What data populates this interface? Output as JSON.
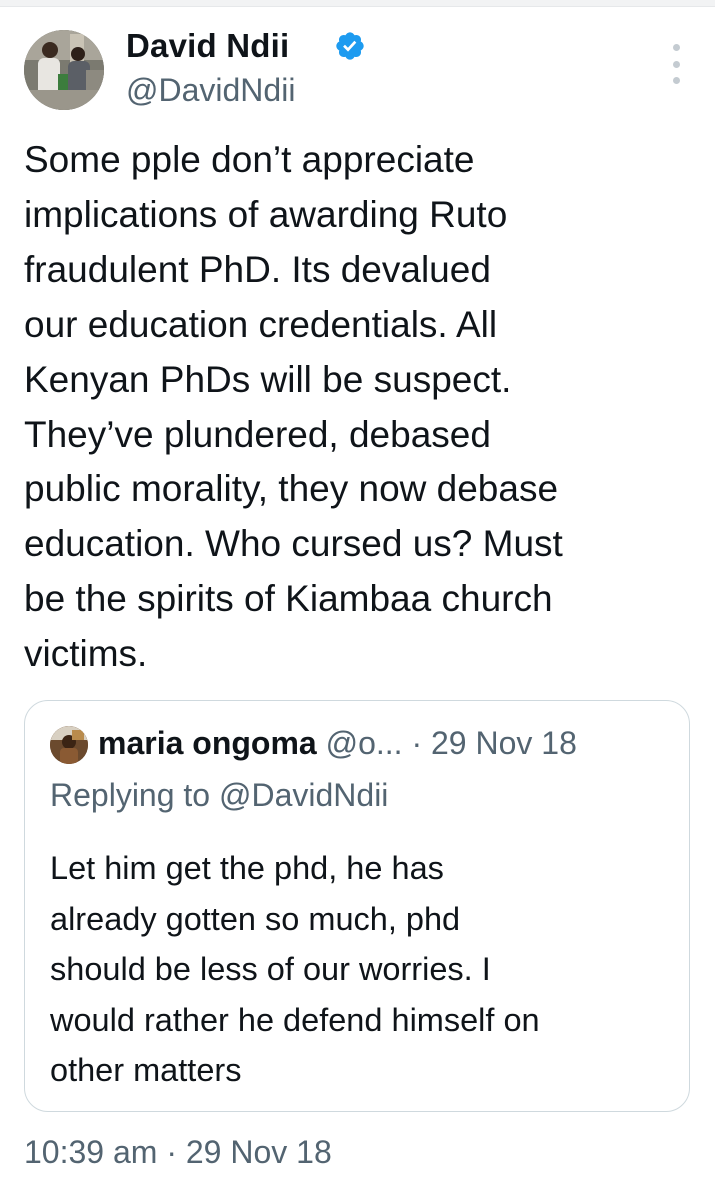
{
  "tweet": {
    "author": {
      "name": "David Ndii",
      "handle": "@DavidNdii",
      "verified": true
    },
    "text_lines": [
      "Some pple don’t appreciate",
      "implications of awarding Ruto",
      "fraudulent PhD. Its devalued",
      "our education credentials. All",
      "Kenyan PhDs will be suspect.",
      "They’ve plundered, debased",
      "public morality, they now debase",
      "education. Who cursed us? Must",
      "be the spirits of Kiambaa church",
      "victims."
    ],
    "time": "10:39 am",
    "separator": "·",
    "date": "29 Nov 18"
  },
  "quoted_tweet": {
    "author_name": "maria ongoma",
    "author_handle": "@o...",
    "separator": "·",
    "date": "29 Nov 18",
    "replying_to": "Replying to @DavidNdii",
    "text_lines": [
      "Let him get the phd, he has",
      "already gotten so much, phd",
      "should be less of our worries. I",
      "would rather he defend himself on",
      "other matters"
    ]
  },
  "colors": {
    "text_primary": "#0f1419",
    "text_secondary": "#536471",
    "verified_badge": "#1d9bf0",
    "quote_border": "#cfd9de"
  },
  "icons": {
    "verified": "verified-badge-icon",
    "more": "more-vertical-icon"
  }
}
